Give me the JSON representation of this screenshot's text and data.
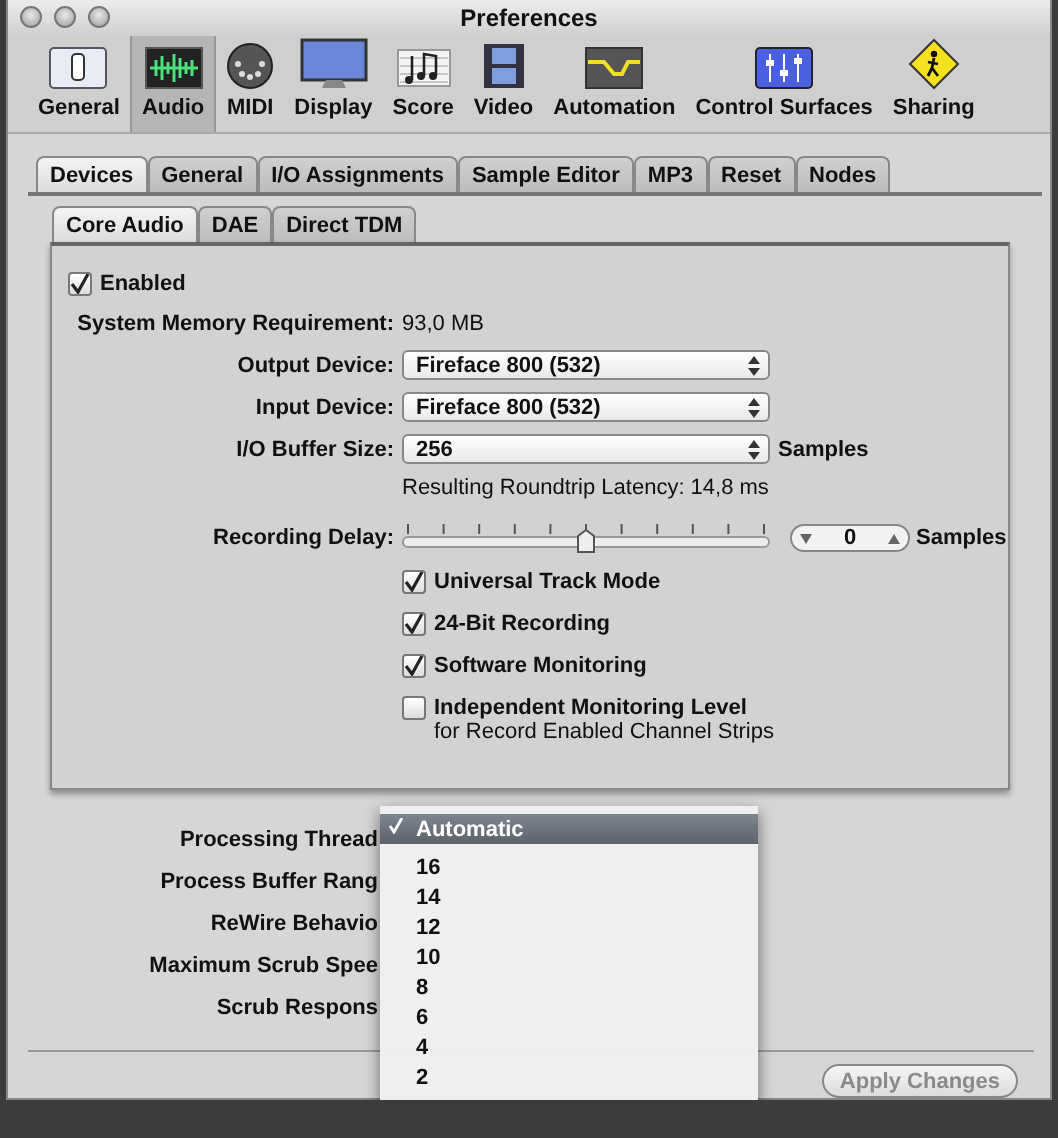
{
  "window": {
    "title": "Preferences"
  },
  "toolbar": [
    {
      "label": "General",
      "kind": "switch",
      "selected": false
    },
    {
      "label": "Audio",
      "kind": "wave",
      "selected": true
    },
    {
      "label": "MIDI",
      "kind": "midi",
      "selected": false
    },
    {
      "label": "Display",
      "kind": "monitor",
      "selected": false
    },
    {
      "label": "Score",
      "kind": "score",
      "selected": false
    },
    {
      "label": "Video",
      "kind": "film",
      "selected": false
    },
    {
      "label": "Automation",
      "kind": "curve",
      "selected": false
    },
    {
      "label": "Control Surfaces",
      "kind": "faders",
      "selected": false
    },
    {
      "label": "Sharing",
      "kind": "sign",
      "selected": false
    }
  ],
  "tabs": [
    {
      "label": "Devices",
      "selected": true
    },
    {
      "label": "General",
      "selected": false
    },
    {
      "label": "I/O Assignments",
      "selected": false
    },
    {
      "label": "Sample Editor",
      "selected": false
    },
    {
      "label": "MP3",
      "selected": false
    },
    {
      "label": "Reset",
      "selected": false
    },
    {
      "label": "Nodes",
      "selected": false
    }
  ],
  "subtabs": [
    {
      "label": "Core Audio",
      "selected": true
    },
    {
      "label": "DAE",
      "selected": false
    },
    {
      "label": "Direct TDM",
      "selected": false
    }
  ],
  "core_audio": {
    "enabled": {
      "label": "Enabled",
      "checked": true
    },
    "memory": {
      "label": "System Memory Requirement:",
      "value": "93,0 MB"
    },
    "selects": [
      {
        "label": "Output Device:",
        "value": "Fireface 800 (532)"
      },
      {
        "label": "Input Device:",
        "value": "Fireface 800 (532)"
      },
      {
        "label": "I/O Buffer Size:",
        "value": "256",
        "unit": "Samples"
      }
    ],
    "latency": "Resulting Roundtrip Latency: 14,8 ms",
    "recording_delay": {
      "label": "Recording Delay:",
      "level": 0.5,
      "value": "0",
      "unit": "Samples"
    },
    "options": [
      {
        "label": "Universal Track Mode",
        "checked": true
      },
      {
        "label": "24-Bit Recording",
        "checked": true
      },
      {
        "label": "Software Monitoring",
        "checked": true
      },
      {
        "label": "Independent Monitoring Level",
        "note": "for Record Enabled Channel Strips",
        "checked": false
      }
    ]
  },
  "settings": [
    {
      "label": "Processing Thread"
    },
    {
      "label": "Process Buffer Rang"
    },
    {
      "label": "ReWire Behavio"
    },
    {
      "label": "Maximum Scrub Spee"
    },
    {
      "label": "Scrub Respons"
    }
  ],
  "menu": {
    "items": [
      {
        "label": "Automatic",
        "selected": true
      },
      {
        "label": "16",
        "selected": false
      },
      {
        "label": "14",
        "selected": false
      },
      {
        "label": "12",
        "selected": false
      },
      {
        "label": "10",
        "selected": false
      },
      {
        "label": "8",
        "selected": false
      },
      {
        "label": "6",
        "selected": false
      },
      {
        "label": "4",
        "selected": false
      },
      {
        "label": "2",
        "selected": false
      }
    ]
  },
  "apply_button": {
    "label": "Apply Changes",
    "disabled": true
  }
}
